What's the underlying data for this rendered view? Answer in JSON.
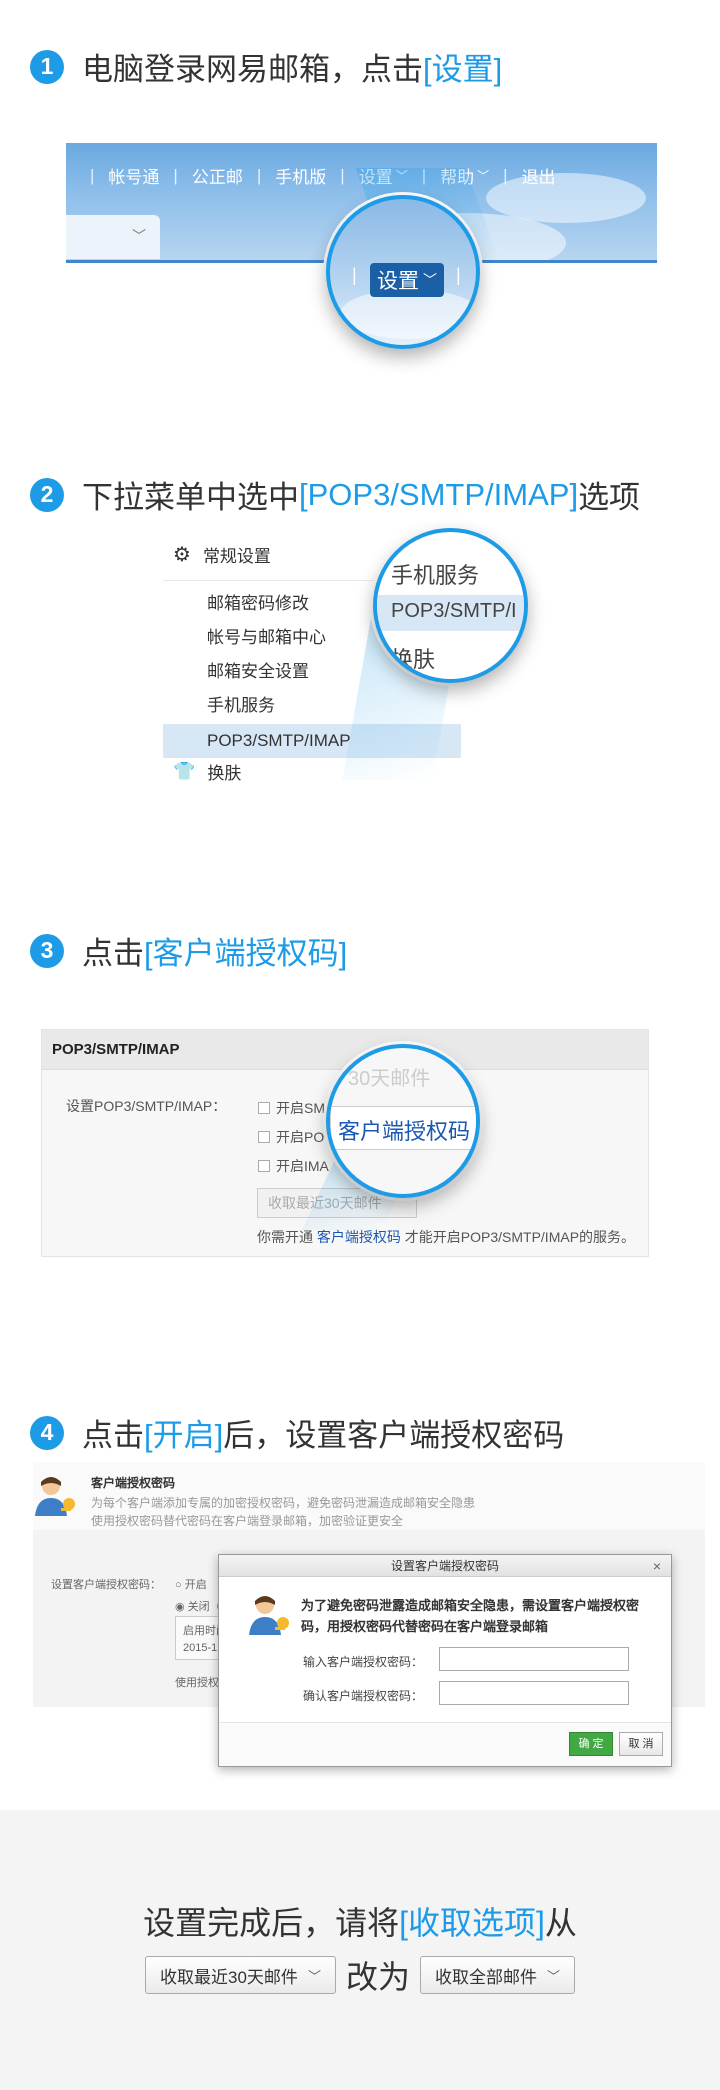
{
  "step1": {
    "num": "1",
    "title_plain": "电脑登录网易邮箱，点击",
    "title_hl": "[设置]",
    "nav": [
      "帐号通",
      "公正邮",
      "手机版",
      "设置",
      "帮助",
      "退出"
    ],
    "zoom_label": "设置"
  },
  "step2": {
    "num": "2",
    "title_plain": "下拉菜单中选中",
    "title_hl": "[POP3/SMTP/IMAP]",
    "title_tail": "选项",
    "menu_head": "常规设置",
    "menu_items": [
      "邮箱密码修改",
      "帐号与邮箱中心",
      "邮箱安全设置",
      "手机服务",
      "POP3/SMTP/IMAP"
    ],
    "menu_foot": "换肤",
    "zoom_items": [
      "手机服务",
      "POP3/SMTP/I",
      "换肤"
    ]
  },
  "step3": {
    "num": "3",
    "title_plain": "点击",
    "title_hl": "[客户端授权码]",
    "box_title": "POP3/SMTP/IMAP",
    "row_label": "设置POP3/SMTP/IMAP：",
    "options": [
      "开启SM",
      "开启PO",
      "开启IMA"
    ],
    "select_text": "收取最近30天邮件",
    "note_pre": "你需开通",
    "note_link": "客户端授权码",
    "note_post": "才能开启POP3/SMTP/IMAP的服务。",
    "zoom_top": "30天邮件",
    "zoom_text": "客户端授权码"
  },
  "step4": {
    "num": "4",
    "title_plain": "点击",
    "title_hl": "[开启]",
    "title_tail": "后，设置客户端授权密码",
    "bg_title": "客户端授权密码",
    "bg_desc1": "为每个客户端添加专属的加密授权密码，避免密码泄漏造成邮箱安全隐患",
    "bg_desc2": "使用授权密码替代密码在客户端登录邮箱，加密验证更安全",
    "bg_label": "设置客户端授权密码：",
    "bg_on": "开启",
    "bg_off": "关闭（",
    "bg_time": "启用时间",
    "bg_date": "2015-1",
    "bg_use": "使用授权",
    "dialog_title": "设置客户端授权密码",
    "dialog_close": "×",
    "warn": "为了避免密码泄露造成邮箱安全隐患，需设置客户端授权密码，用授权密码代替密码在客户端登录邮箱",
    "input_label1": "输入客户端授权密码：",
    "input_label2": "确认客户端授权密码：",
    "ok": "确 定",
    "cancel": "取 消"
  },
  "footer": {
    "line1_plain": "设置完成后，请将",
    "line1_hl": "[收取选项]",
    "line1_tail": "从",
    "from_option": "收取最近30天邮件",
    "change_to": "改为",
    "to_option": "收取全部邮件"
  },
  "colors": {
    "accent": "#1d9be6",
    "link": "#1a58b3",
    "ok_green": "#42a843"
  },
  "icons": [
    "gear-icon",
    "shirt-icon",
    "user-key-icon",
    "chevron-down-icon",
    "close-icon"
  ]
}
